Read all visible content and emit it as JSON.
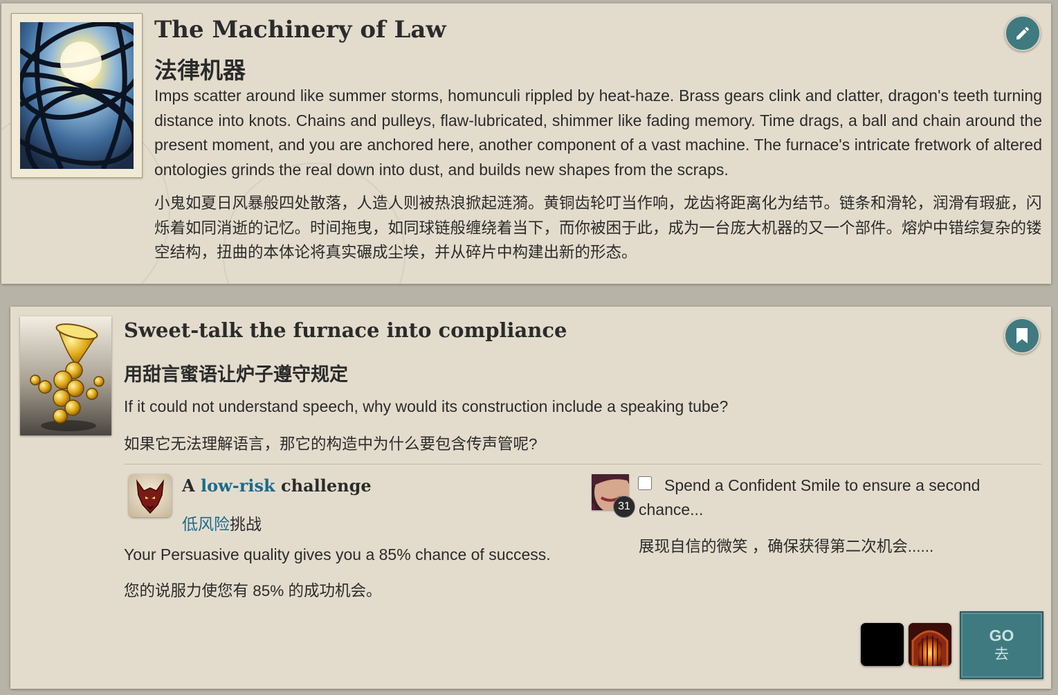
{
  "storylet": {
    "title": "The Machinery of Law",
    "title_zh": "法律机器",
    "description": "Imps scatter around like summer storms, homunculi rippled by heat-haze. Brass gears clink and clatter, dragon's teeth turning distance into knots. Chains and pulleys, flaw-lubricated, shimmer like fading memory. Time drags, a ball and chain around the present moment, and you are anchored here, another component of a vast machine. The furnace's intricate fretwork of altered ontologies grinds the real down into dust, and builds new shapes from the scraps.",
    "description_zh": "小鬼如夏日风暴般四处散落，人造人则被热浪掀起涟漪。黄铜齿轮叮当作响，龙齿将距离化为结节。链条和滑轮，润滑有瑕疵，闪烁着如同消逝的记忆。时间拖曳，如同球链般缠绕着当下，而你被困于此，成为一台庞大机器的又一个部件。熔炉中错综复杂的镂空结构，扭曲的本体论将真实碾成尘埃，并从碎片中构建出新的形态。",
    "edit_icon": "pencil-icon"
  },
  "branch": {
    "title": "Sweet-talk the furnace into compliance",
    "title_zh": "用甜言蜜语让炉子遵守规定",
    "description": "If it could not understand speech, why would its construction include a speaking tube?",
    "description_zh": "如果它无法理解语言，那它的构造中为什么要包含传声管呢?",
    "bookmark_icon": "bookmark-icon",
    "challenge": {
      "prefix": "A",
      "risk": "low-risk",
      "suffix": "challenge",
      "risk_zh": "低风险",
      "suffix_zh": "挑战",
      "description": "Your Persuasive quality gives you a 85% chance of success.",
      "description_zh": "您的说服力使您有 85% 的成功机会。",
      "icon": "wolf-icon"
    },
    "option": {
      "quality_count": "31",
      "text": "Spend a Confident Smile to ensure a second chance...",
      "text_zh": "展现自信的微笑 ，确保获得第二次机会......",
      "checked": false
    },
    "go": {
      "label": "GO",
      "label_zh": "去"
    }
  },
  "colors": {
    "card_bg": "#e3dccd",
    "page_bg": "#b8b3a7",
    "accent": "#3f7a80",
    "link": "#1a6a8e"
  }
}
